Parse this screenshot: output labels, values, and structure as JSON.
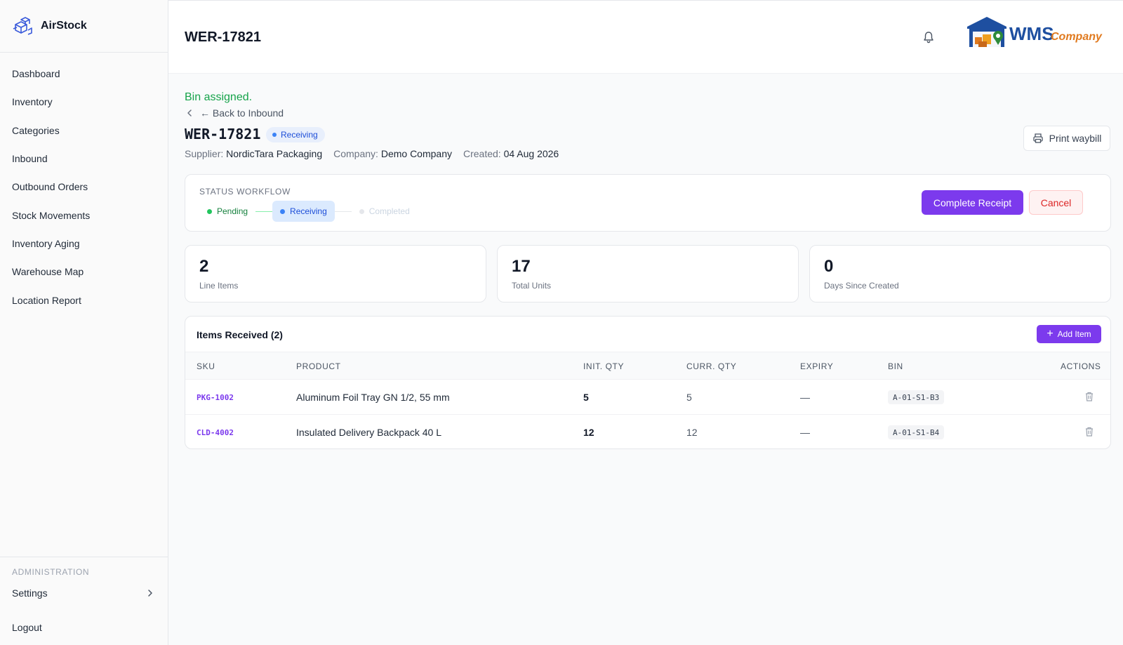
{
  "app": {
    "name": "AirStock"
  },
  "sidebar": {
    "items": [
      {
        "label": "Dashboard"
      },
      {
        "label": "Inventory"
      },
      {
        "label": "Categories"
      },
      {
        "label": "Inbound"
      },
      {
        "label": "Outbound Orders"
      },
      {
        "label": "Stock Movements"
      },
      {
        "label": "Inventory Aging"
      },
      {
        "label": "Warehouse Map"
      },
      {
        "label": "Location Report"
      }
    ],
    "admin_label": "ADMINISTRATION",
    "settings_label": "Settings",
    "logout_label": "Logout"
  },
  "header": {
    "title": "WER-17821",
    "logo_text_main": "WMS",
    "logo_text_sub": "Company"
  },
  "page": {
    "flash": "Bin assigned.",
    "back_label": "← Back to Inbound",
    "doc_id": "WER-17821",
    "status": "Receiving",
    "supplier_label": "Supplier:",
    "supplier": "NordicTara Packaging",
    "company_label": "Company:",
    "company": "Demo Company",
    "created_label": "Created:",
    "created": "04 Aug 2026",
    "print_label": "Print waybill"
  },
  "workflow": {
    "label": "STATUS WORKFLOW",
    "steps": [
      {
        "label": "Pending",
        "state": "done"
      },
      {
        "label": "Receiving",
        "state": "active"
      },
      {
        "label": "Completed",
        "state": "pending"
      }
    ],
    "complete_label": "Complete Receipt",
    "cancel_label": "Cancel"
  },
  "stats": [
    {
      "value": "2",
      "label": "Line Items"
    },
    {
      "value": "17",
      "label": "Total Units"
    },
    {
      "value": "0",
      "label": "Days Since Created"
    }
  ],
  "items": {
    "title": "Items Received (2)",
    "add_label": "Add Item",
    "columns": [
      "SKU",
      "PRODUCT",
      "INIT. QTY",
      "CURR. QTY",
      "EXPIRY",
      "BIN",
      "ACTIONS"
    ],
    "rows": [
      {
        "sku": "PKG-1002",
        "product": "Aluminum Foil Tray GN 1/2, 55 mm",
        "init_qty": "5",
        "curr_qty": "5",
        "expiry": "—",
        "bin": "A-01-S1-B3"
      },
      {
        "sku": "CLD-4002",
        "product": "Insulated Delivery Backpack 40 L",
        "init_qty": "12",
        "curr_qty": "12",
        "expiry": "—",
        "bin": "A-01-S1-B4"
      }
    ]
  },
  "colors": {
    "accent": "#7c3aed",
    "success": "#16a34a",
    "info": "#1d4ed8",
    "danger": "#dc2626"
  },
  "icons": {
    "brand": "warehouse-boxes-icon",
    "bell": "bell-icon",
    "print": "printer-icon",
    "trash": "trash-icon",
    "chevron": "chevron-right-icon",
    "back": "chevron-left-icon",
    "plus": "plus-icon"
  }
}
